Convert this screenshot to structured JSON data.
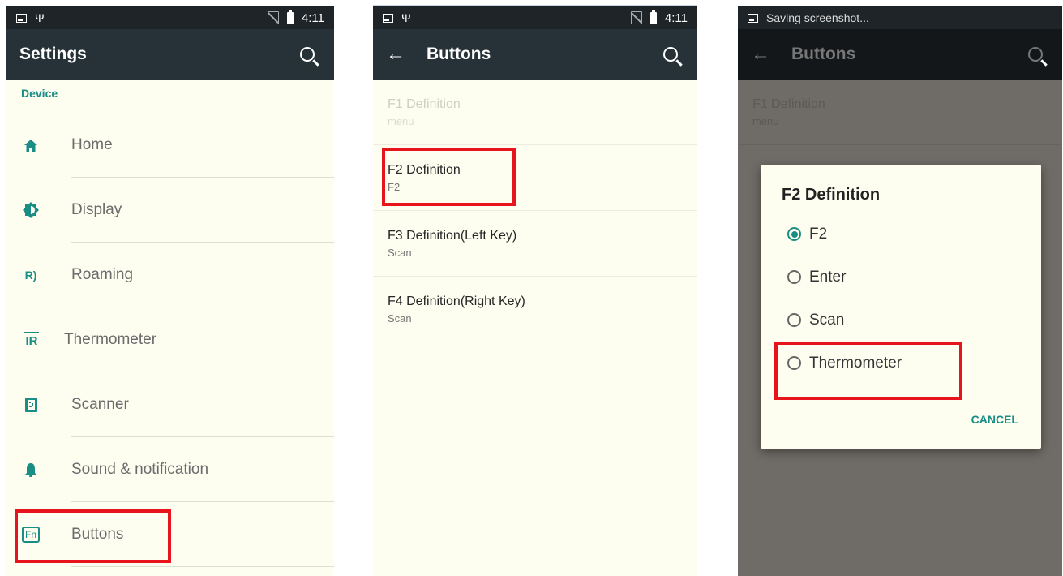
{
  "panel1": {
    "status_time": "4:11",
    "title": "Settings",
    "section": "Device",
    "items": [
      {
        "label": "Home",
        "icon": "home-icon"
      },
      {
        "label": "Display",
        "icon": "brightness-icon"
      },
      {
        "label": "Roaming",
        "icon": "roaming-icon"
      },
      {
        "label": "Thermometer",
        "icon": "ir-icon"
      },
      {
        "label": "Scanner",
        "icon": "scanner-icon"
      },
      {
        "label": "Sound & notification",
        "icon": "bell-icon"
      },
      {
        "label": "Buttons",
        "icon": "fn-icon"
      }
    ],
    "ir_glyph": "IR",
    "fn_glyph": "Fn"
  },
  "panel2": {
    "status_time": "4:11",
    "title": "Buttons",
    "items": [
      {
        "title": "F1 Definition",
        "summary": "menu"
      },
      {
        "title": "F2 Definition",
        "summary": "F2"
      },
      {
        "title": "F3 Definition(Left Key)",
        "summary": "Scan"
      },
      {
        "title": "F4 Definition(Right Key)",
        "summary": "Scan"
      }
    ]
  },
  "panel3": {
    "status_text": "Saving screenshot...",
    "title": "Buttons",
    "bg_items": [
      {
        "title": "F1 Definition",
        "summary": "menu"
      }
    ],
    "dialog": {
      "title": "F2 Definition",
      "options": [
        "F2",
        "Enter",
        "Scan",
        "Thermometer"
      ],
      "selected": "F2",
      "cancel": "CANCEL"
    }
  },
  "colors": {
    "accent": "#1a8e84",
    "appbar": "#263238",
    "highlight": "#e8141d"
  }
}
